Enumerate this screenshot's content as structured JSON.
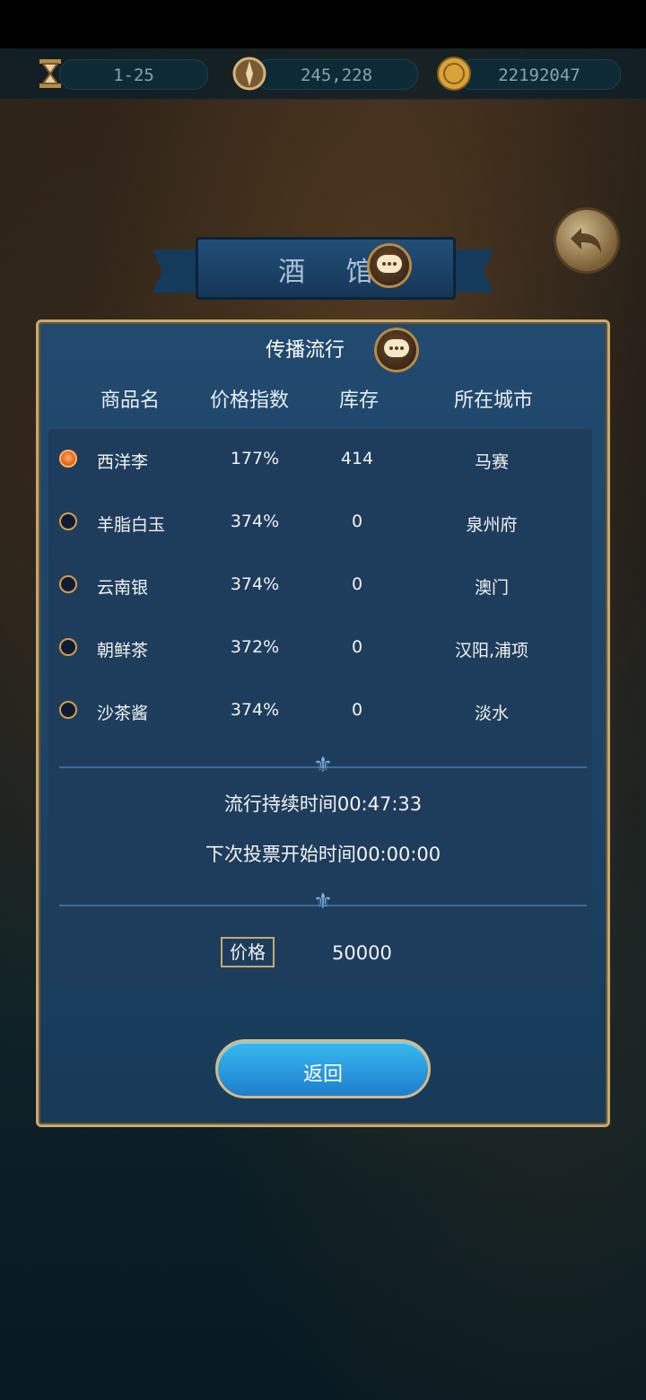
{
  "status_bar": {
    "resources": [
      {
        "icon": "hourglass-icon",
        "value": "1-25"
      },
      {
        "icon": "compass-icon",
        "value": "245,228"
      },
      {
        "icon": "gold-coin-icon",
        "value": "22192047"
      }
    ]
  },
  "header": {
    "title": "酒 馆"
  },
  "panel": {
    "title": "传播流行",
    "columns": [
      "商品名",
      "价格指数",
      "库存",
      "所在城市"
    ],
    "rows": [
      {
        "name": "西洋李",
        "price_index": "177%",
        "stock": "414",
        "city": "马赛",
        "selected": true
      },
      {
        "name": "羊脂白玉",
        "price_index": "374%",
        "stock": "0",
        "city": "泉州府",
        "selected": false
      },
      {
        "name": "云南银",
        "price_index": "374%",
        "stock": "0",
        "city": "澳门",
        "selected": false
      },
      {
        "name": "朝鲜茶",
        "price_index": "372%",
        "stock": "0",
        "city": "汉阳,浦项",
        "selected": false
      },
      {
        "name": "沙茶酱",
        "price_index": "374%",
        "stock": "0",
        "city": "淡水",
        "selected": false
      }
    ],
    "duration_text": "流行持续时间00:47:33",
    "next_vote_text": "下次投票开始时间00:00:00",
    "price_label": "价格",
    "price_value": "50000",
    "return_label": "返回"
  },
  "colors": {
    "accent": "#c8a870",
    "panel": "#1c4264",
    "button": "#2b9ee0",
    "selected_radio": "#e35c14"
  }
}
